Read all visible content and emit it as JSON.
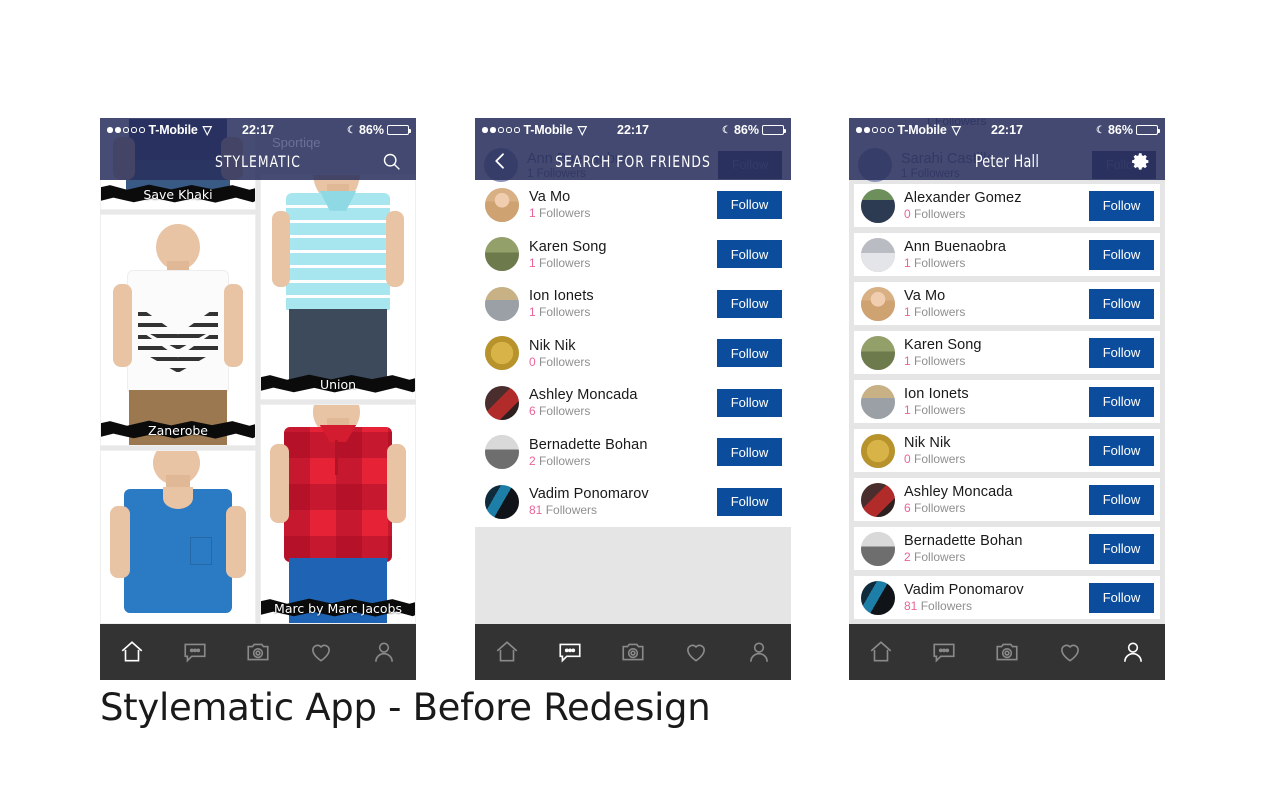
{
  "caption": "Stylematic App - Before Redesign",
  "status_bar": {
    "carrier": "T-Mobile",
    "time": "22:17",
    "battery_pct": "86%",
    "signal_dots_filled": 2,
    "signal_dots_total": 5,
    "wifi_icon": "wifi-icon",
    "moon_icon": "moon-icon"
  },
  "colors": {
    "nav_blue": "#2b3161",
    "follow_blue": "#0b4d9c",
    "count_pink": "#e8659a",
    "tabbar_dark": "#333333",
    "list_gray": "#e5e5e5"
  },
  "screen1": {
    "nav_title": "STYLEMATIC",
    "search_icon": "search-icon",
    "ghost_brand": "Sportiqe",
    "products": [
      {
        "brand": "Save Khaki",
        "column": "left"
      },
      {
        "brand": "Zanerobe",
        "column": "left"
      },
      {
        "brand": "",
        "column": "left"
      },
      {
        "brand": "Union",
        "column": "right"
      },
      {
        "brand": "Marc by Marc Jacobs",
        "column": "right"
      }
    ],
    "tabs": [
      {
        "name": "home",
        "icon": "home-icon",
        "active": true
      },
      {
        "name": "messages",
        "icon": "chat-bubble-icon",
        "active": false
      },
      {
        "name": "camera",
        "icon": "camera-icon",
        "active": false
      },
      {
        "name": "likes",
        "icon": "heart-icon",
        "active": false
      },
      {
        "name": "profile",
        "icon": "person-icon",
        "active": false
      }
    ]
  },
  "screen2": {
    "nav_title": "SEARCH FOR FRIENDS",
    "back_icon": "back-chevron-icon",
    "ghost_row": {
      "name": "Ann Buenaobra",
      "followers": "1 Followers",
      "follow_label": "Follow"
    },
    "follow_label": "Follow",
    "followers_suffix": " Followers",
    "users": [
      {
        "name": "Va Mo",
        "count": "1",
        "followers": "1 Followers"
      },
      {
        "name": "Karen Song",
        "count": "1",
        "followers": "1 Followers"
      },
      {
        "name": "Ion Ionets",
        "count": "1",
        "followers": "1 Followers"
      },
      {
        "name": "Nik Nik",
        "count": "0",
        "followers": "0 Followers"
      },
      {
        "name": "Ashley Moncada",
        "count": "6",
        "followers": "6 Followers"
      },
      {
        "name": "Bernadette Bohan",
        "count": "2",
        "followers": "2 Followers"
      },
      {
        "name": "Vadim Ponomarov",
        "count": "81",
        "followers": "81 Followers"
      }
    ],
    "tabs": [
      {
        "name": "home",
        "icon": "home-icon",
        "active": false
      },
      {
        "name": "messages",
        "icon": "chat-bubble-icon",
        "active": true
      },
      {
        "name": "camera",
        "icon": "camera-icon",
        "active": false
      },
      {
        "name": "likes",
        "icon": "heart-icon",
        "active": false
      },
      {
        "name": "profile",
        "icon": "person-icon",
        "active": false
      }
    ]
  },
  "screen3": {
    "nav_title": "Peter Hall",
    "settings_icon": "gear-icon",
    "ghost_top_text": "1 Followers",
    "ghost_row": {
      "name": "Sarahi Castillo",
      "followers": "1 Followers",
      "follow_label": "Follow"
    },
    "follow_label": "Follow",
    "users": [
      {
        "name": "Alexander Gomez",
        "count": "0",
        "followers": "0 Followers"
      },
      {
        "name": "Ann Buenaobra",
        "count": "1",
        "followers": "1 Followers"
      },
      {
        "name": "Va Mo",
        "count": "1",
        "followers": "1 Followers"
      },
      {
        "name": "Karen Song",
        "count": "1",
        "followers": "1 Followers"
      },
      {
        "name": "Ion Ionets",
        "count": "1",
        "followers": "1 Followers"
      },
      {
        "name": "Nik Nik",
        "count": "0",
        "followers": "0 Followers"
      },
      {
        "name": "Ashley Moncada",
        "count": "6",
        "followers": "6 Followers"
      },
      {
        "name": "Bernadette Bohan",
        "count": "2",
        "followers": "2 Followers"
      },
      {
        "name": "Vadim Ponomarov",
        "count": "81",
        "followers": "81 Followers"
      }
    ],
    "tabs": [
      {
        "name": "home",
        "icon": "home-icon",
        "active": false
      },
      {
        "name": "messages",
        "icon": "chat-bubble-icon",
        "active": false
      },
      {
        "name": "camera",
        "icon": "camera-icon",
        "active": false
      },
      {
        "name": "likes",
        "icon": "heart-icon",
        "active": false
      },
      {
        "name": "profile",
        "icon": "person-icon",
        "active": true
      }
    ]
  }
}
